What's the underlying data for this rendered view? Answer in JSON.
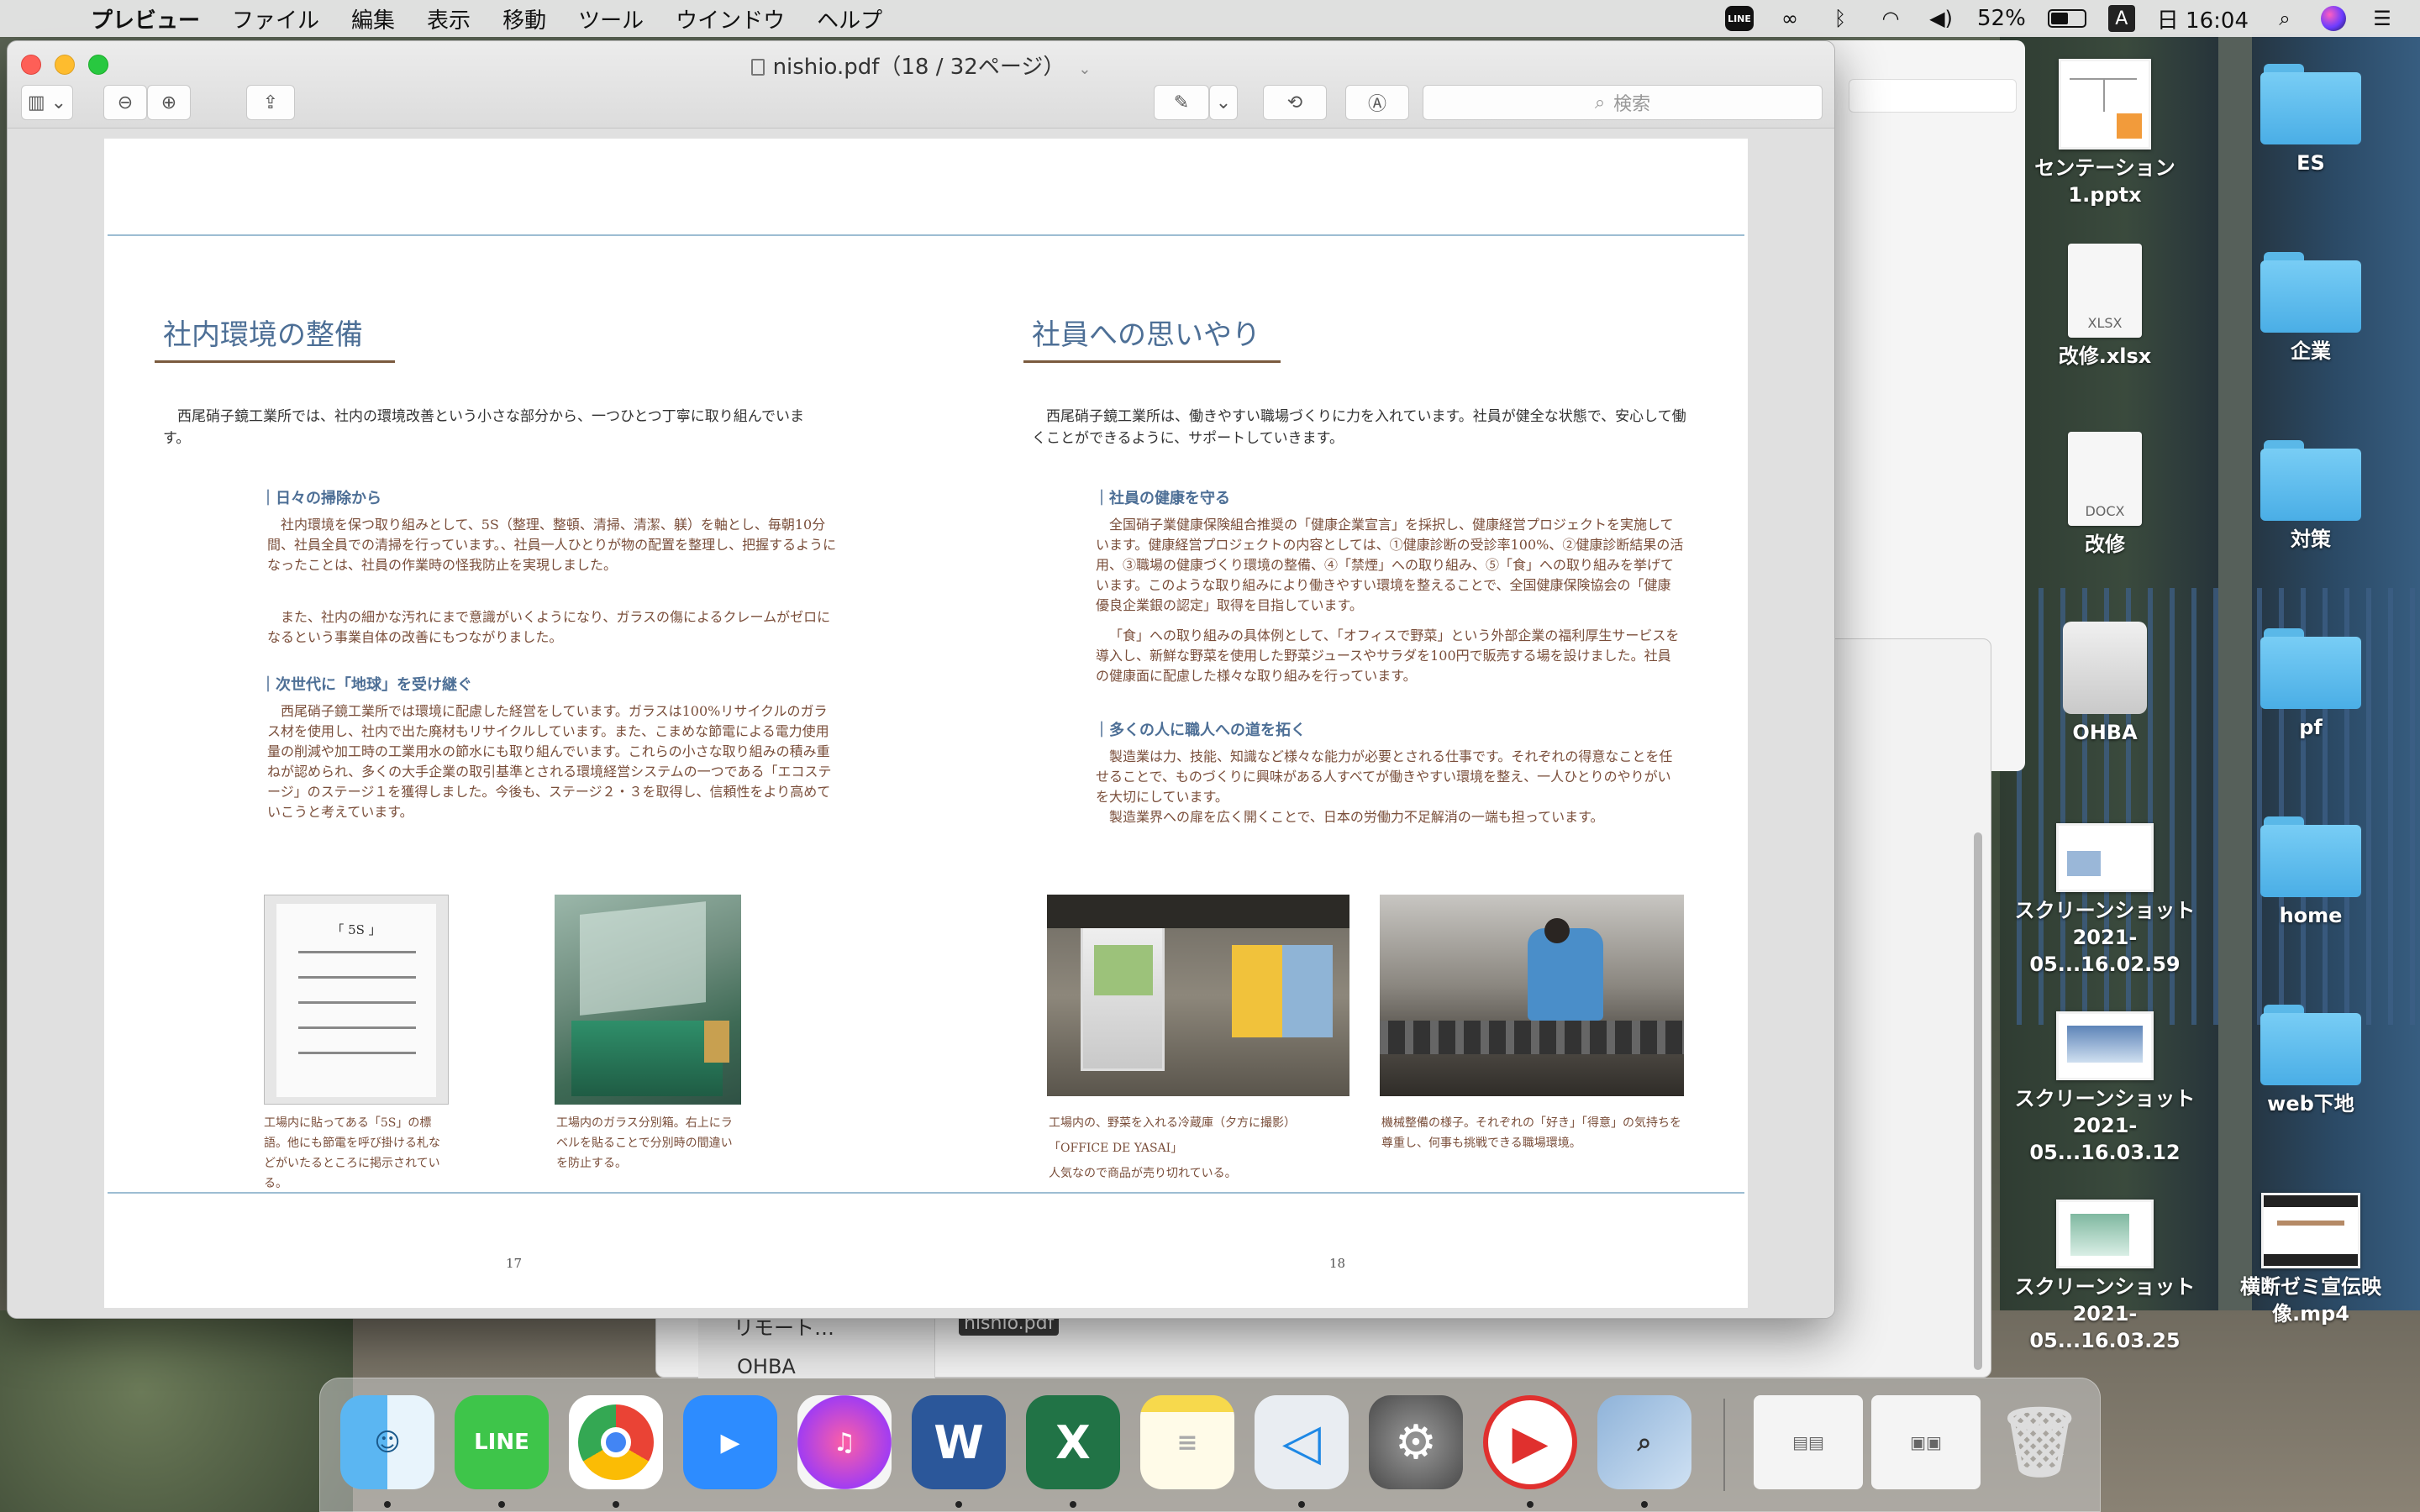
{
  "menubar": {
    "app": "プレビュー",
    "items": [
      "ファイル",
      "編集",
      "表示",
      "移動",
      "ツール",
      "ウインドウ",
      "ヘルプ"
    ],
    "battery": "52%",
    "input_mode": "A",
    "clock": "日 16:04",
    "battery_level": 0.52
  },
  "window": {
    "title": "nishio.pdf（18 / 32ページ）",
    "search_placeholder": "検索"
  },
  "page_left": {
    "heading": "社内環境の整備",
    "intro": "西尾硝子鏡工業所では、社内の環境改善という小さな部分から、一つひとつ丁寧に取り組んでいます。",
    "sub1": "｜日々の掃除から",
    "para1a": "社内環境を保つ取り組みとして、5S（整理、整頓、清掃、清潔、躾）を軸とし、毎朝10分間、社員全員での清掃を行っています。、社員一人ひとりが物の配置を整理し、把握するようになったことは、社員の作業時の怪我防止を実現しました。",
    "para1b": "また、社内の細かな汚れにまで意識がいくようになり、ガラスの傷によるクレームがゼロになるという事業自体の改善にもつながりました。",
    "sub2": "｜次世代に「地球」を受け継ぐ",
    "para2": "西尾硝子鏡工業所では環境に配慮した経営をしています。ガラスは100%リサイクルのガラス材を使用し、社内で出た廃材もリサイクルしています。また、こまめな節電による電力使用量の削減や加工時の工業用水の節水にも取り組んでいます。これらの小さな取り組みの積み重ねが認められ、多くの大手企業の取引基準とされる環境経営システムの一つである「エコステージ」のステージ１を獲得しました。今後も、ステージ２・３を取得し、信頼性をより高めていこうと考えています。",
    "photo1_text": "「 5S 」",
    "caption1": "工場内に貼ってある「5S」の標語。他にも節電を呼び掛ける札などがいたるところに掲示されている。",
    "caption2": "工場内のガラス分別箱。右上にラベルを貼ることで分別時の間違いを防止する。",
    "page_number": "17"
  },
  "page_right": {
    "heading": "社員への思いやり",
    "intro": "西尾硝子鏡工業所は、働きやすい職場づくりに力を入れています。社員が健全な状態で、安心して働くことができるように、サポートしていきます。",
    "sub1": "｜社員の健康を守る",
    "para1a": "全国硝子業健康保険組合推奨の「健康企業宣言」を採択し、健康経営プロジェクトを実施しています。健康経営プロジェクトの内容としては、①健康診断の受診率100%、②健康診断結果の活用、③職場の健康づくり環境の整備、④「禁煙」への取り組み、⑤「食」への取り組みを挙げています。このような取り組みにより働きやすい環境を整えることで、全国健康保険協会の「健康優良企業銀の認定」取得を目指しています。",
    "para1b": "「食」への取り組みの具体例として、「オフィスで野菜」という外部企業の福利厚生サービスを導入し、新鮮な野菜を使用した野菜ジュースやサラダを100円で販売する場を設けました。社員の健康面に配慮した様々な取り組みを行っています。",
    "sub2": "｜多くの人に職人への道を拓く",
    "para2a": "製造業は力、技能、知識など様々な能力が必要とされる仕事です。それぞれの得意なことを任せることで、ものづくりに興味がある人すべてが働きやすい環境を整え、一人ひとりのやりがいを大切にしています。",
    "para2b": "製造業界への扉を広く開くことで、日本の労働力不足解消の一端も担っています。",
    "caption3_line1": "工場内の、野菜を入れる冷蔵庫（夕方に撮影）",
    "caption3_line2": "「OFFICE DE YASAI」",
    "caption3_line3": "人気なので商品が売り切れている。",
    "caption4": "機械整備の様子。それぞれの「好き」「得意」の気持ちを尊重し、何事も挑戦できる職場環境。",
    "page_number": "18"
  },
  "bg_finder": {
    "sidebar": [
      "リモート…",
      "OHBA"
    ],
    "file": "nishio.pdf"
  },
  "desktop": {
    "left_column": [
      "センテーション1.pptx",
      "改修.xlsx",
      "改修",
      "OHBA",
      "スクリーンショット 2021-05...16.02.59",
      "スクリーンショット 2021-05...16.03.12",
      "スクリーンショット 2021-05...16.03.25"
    ],
    "right_column": [
      "ES",
      "企業",
      "対策",
      "pf",
      "home",
      "web下地",
      "横断ゼミ宣伝映像.mp4"
    ],
    "file_types": [
      "XLSX",
      "DOCX"
    ]
  },
  "dock": [
    "Finder",
    "LINE",
    "Chrome",
    "Zoom",
    "Music",
    "Word",
    "Excel",
    "Notes",
    "VS Code",
    "System Preferences",
    "Presenter",
    "Preview",
    "Downloads",
    "Screenshots",
    "Trash"
  ],
  "colors": {
    "heading": "#4d6f96",
    "body_brown": "#7a4e3a",
    "rule": "#9dbdd3",
    "folder": "#5ab8e8"
  }
}
